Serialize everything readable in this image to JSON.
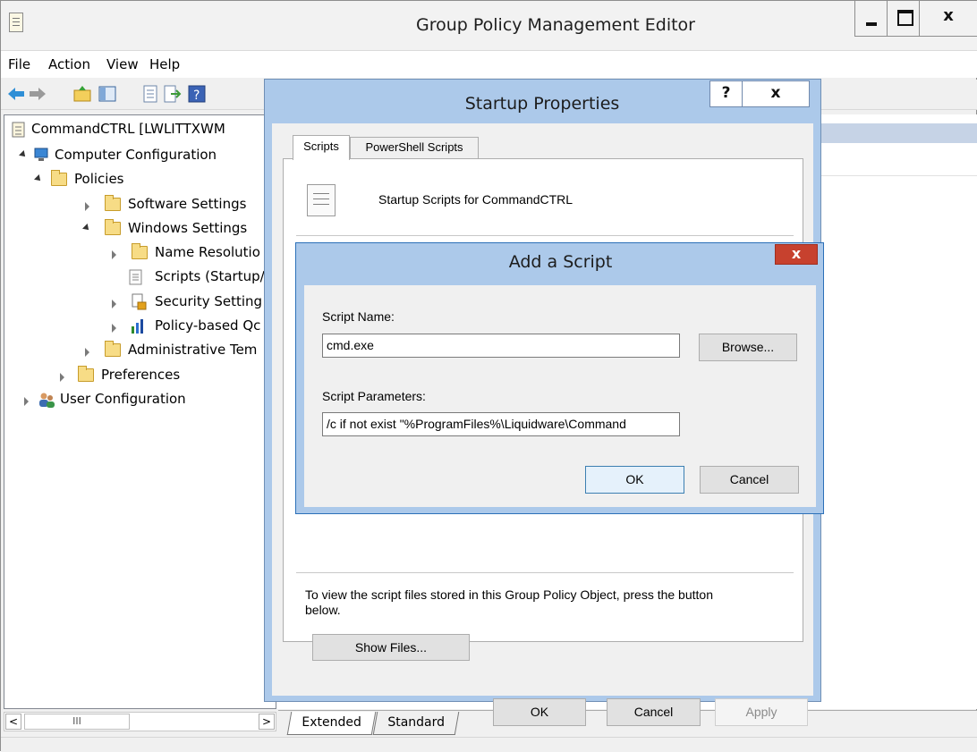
{
  "app": {
    "title": "Group Policy Management Editor"
  },
  "window_buttons": {
    "close": "x"
  },
  "menu": [
    "File",
    "Action",
    "View",
    "Help"
  ],
  "tree": [
    {
      "label": "CommandCTRL [LWLITTXWM"
    },
    {
      "label": "Computer Configuration"
    },
    {
      "label": "Policies"
    },
    {
      "label": "Software Settings"
    },
    {
      "label": "Windows Settings"
    },
    {
      "label": "Name Resolutio"
    },
    {
      "label": "Scripts (Startup/"
    },
    {
      "label": "Security Setting"
    },
    {
      "label": "Policy-based Qc"
    },
    {
      "label": "Administrative Tem"
    },
    {
      "label": "Preferences"
    },
    {
      "label": "User Configuration"
    }
  ],
  "scrollbar": {
    "left": "<",
    "thumb": "III",
    "right": ">"
  },
  "bottom_tabs": {
    "extended": "Extended",
    "standard": "Standard"
  },
  "startup_dialog": {
    "title": "Startup Properties",
    "help": "?",
    "close": "x",
    "tabs": [
      "Scripts",
      "PowerShell Scripts"
    ],
    "heading": "Startup Scripts for CommandCTRL",
    "view_files_text": "To view the script files stored in this Group Policy Object, press the button below.",
    "show_files": "Show Files...",
    "ok": "OK",
    "cancel": "Cancel",
    "apply": "Apply"
  },
  "add_script_dialog": {
    "title": "Add a Script",
    "close": "x",
    "script_name_label": "Script Name:",
    "script_name_value": "cmd.exe",
    "browse": "Browse...",
    "script_params_label": "Script Parameters:",
    "script_params_value": "/c if not exist \"%ProgramFiles%\\Liquidware\\Command",
    "ok": "OK",
    "cancel": "Cancel"
  }
}
